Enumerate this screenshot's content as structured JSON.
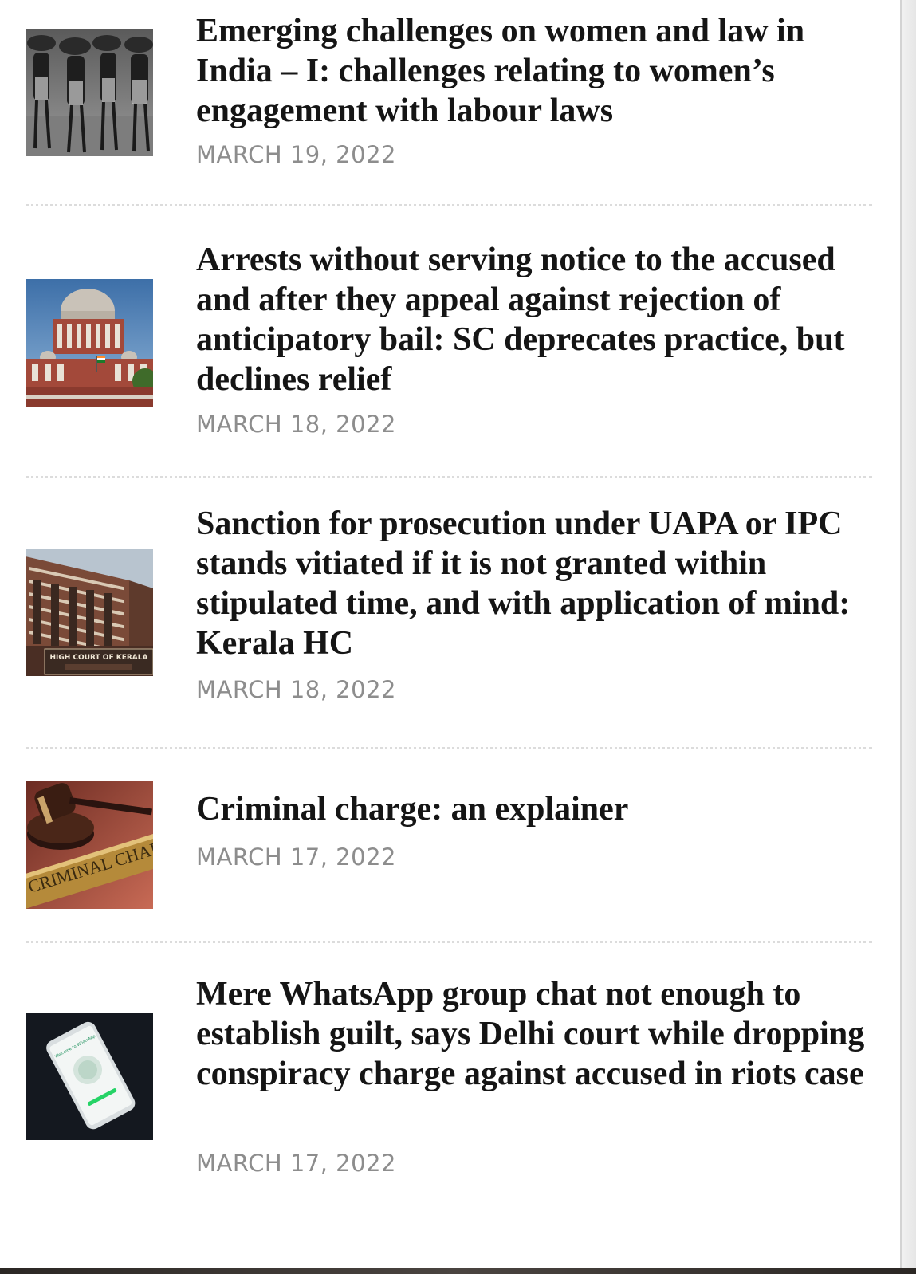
{
  "posts": [
    {
      "title": "Emerging challenges on women and law in India – I: challenges relating to women’s engagement with labour laws",
      "date": "MARCH 19, 2022"
    },
    {
      "title": "Arrests without serving notice to the accused and after they appeal against rejection of anticipatory bail: SC deprecates practice, but declines relief",
      "date": "MARCH 18, 2022"
    },
    {
      "title": "Sanction for prosecution under UAPA or IPC stands vitiated if it is not granted within stipulated time, and with application of mind: Kerala HC",
      "date": "MARCH 18, 2022"
    },
    {
      "title": "Criminal charge: an explainer",
      "date": "MARCH 17, 2022"
    },
    {
      "title": "Mere WhatsApp group chat not enough to establish guilt, says Delhi court while dropping conspiracy charge against accused in riots case",
      "date": "MARCH 17, 2022"
    }
  ],
  "thumb_text": {
    "high_court_sign": "HIGH COURT OF KERALA",
    "criminal_plaque": "CRIMINAL CHARGE",
    "whatsapp_screen": "Welcome to WhatsApp"
  }
}
